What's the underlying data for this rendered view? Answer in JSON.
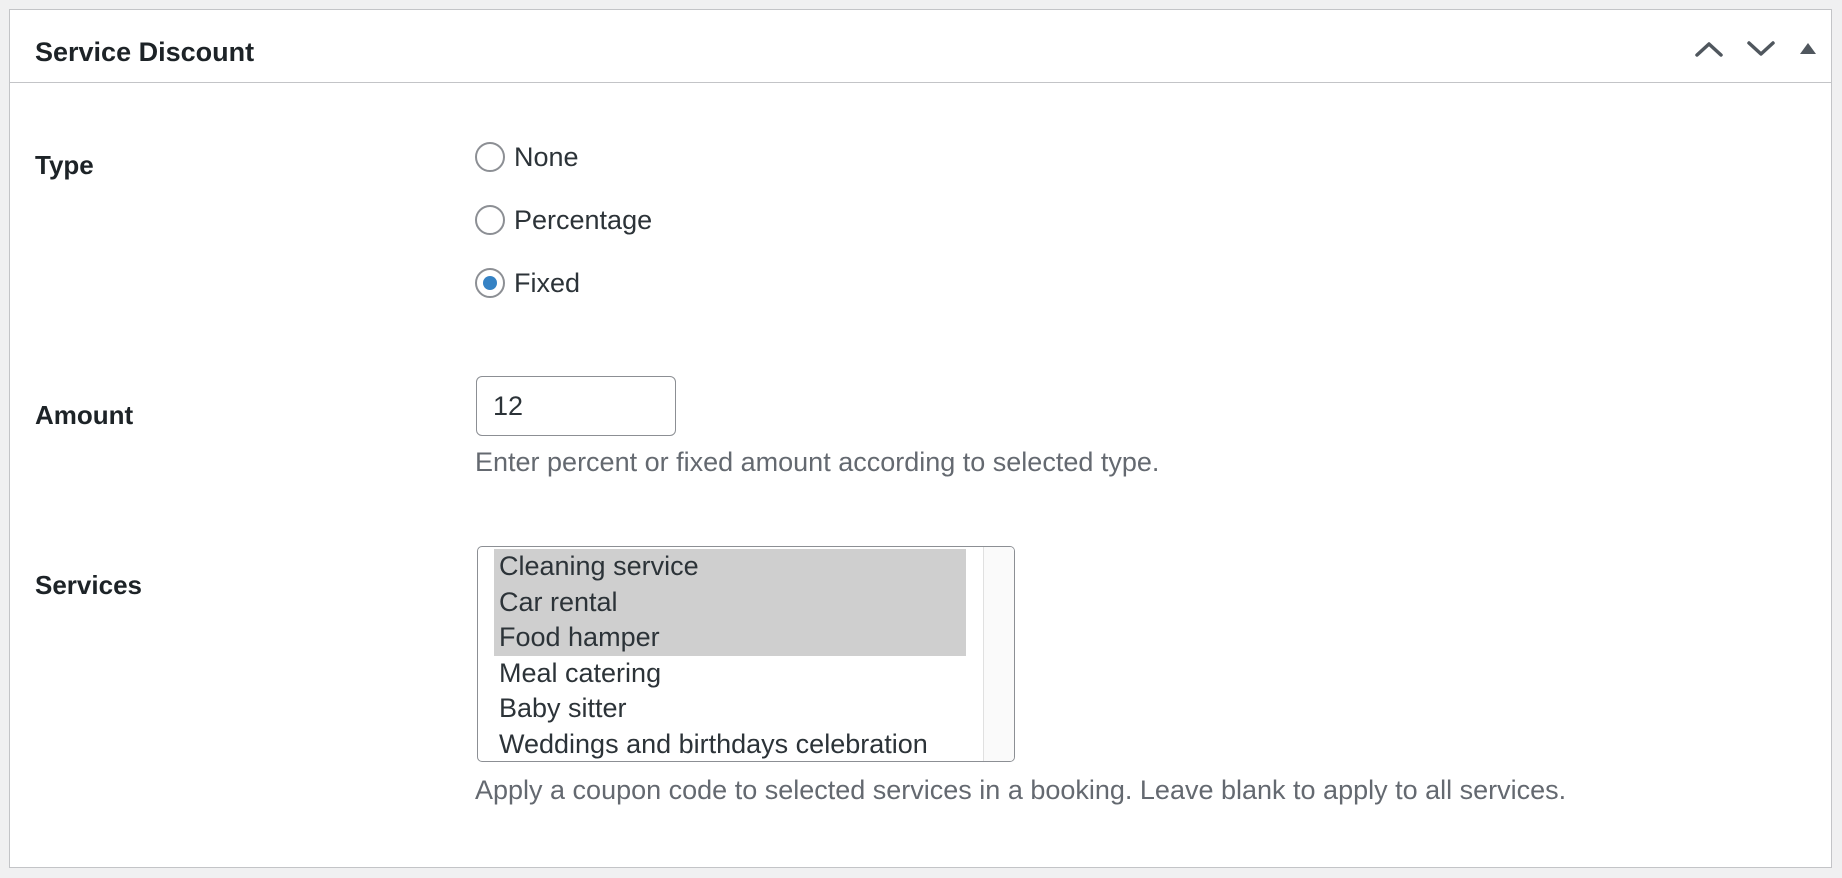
{
  "metabox": {
    "title": "Service Discount",
    "controls": {
      "move_up_icon": "chevron-up-icon",
      "move_down_icon": "chevron-down-icon",
      "toggle_icon": "triangle-up-icon"
    }
  },
  "type_field": {
    "label": "Type",
    "options": [
      {
        "label": "None",
        "checked": false
      },
      {
        "label": "Percentage",
        "checked": false
      },
      {
        "label": "Fixed",
        "checked": true
      }
    ]
  },
  "amount_field": {
    "label": "Amount",
    "value": "12",
    "help": "Enter percent or fixed amount according to selected type."
  },
  "services_field": {
    "label": "Services",
    "options": [
      {
        "label": "Cleaning service",
        "selected": true
      },
      {
        "label": "Car rental",
        "selected": true
      },
      {
        "label": "Food hamper",
        "selected": true
      },
      {
        "label": "Meal catering",
        "selected": false
      },
      {
        "label": "Baby sitter",
        "selected": false
      },
      {
        "label": "Weddings and birthdays celebration",
        "selected": false
      }
    ],
    "help": "Apply a coupon code to selected services in a booking. Leave blank to apply to all services."
  },
  "colors": {
    "page_background": "#f0f0f1",
    "panel_background": "#ffffff",
    "border": "#c3c4c7",
    "radio_checked": "#3582c4",
    "selected_option": "#cfcfcf",
    "help_text": "#646970"
  }
}
